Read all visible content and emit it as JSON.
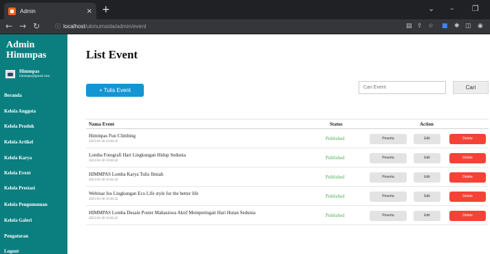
{
  "browser": {
    "tab_title": "Admin",
    "tab_close": "×",
    "new_tab": "+",
    "url_host": "localhost",
    "url_path": "/ukmumsida/admin/event",
    "controls": {
      "minimize": "–",
      "maximize": "❐",
      "chevron": "⌄"
    }
  },
  "sidebar": {
    "title": "Admin Himmpas",
    "profile": {
      "name": "Himmpas",
      "email": "himmpas@gmail.com"
    },
    "items": [
      {
        "label": "Beranda"
      },
      {
        "label": "Kelola Anggota"
      },
      {
        "label": "Kelola Produk"
      },
      {
        "label": "Kelola Artikel"
      },
      {
        "label": "Kelola Karya"
      },
      {
        "label": "Kelola Event"
      },
      {
        "label": "Kelola Prestasi"
      },
      {
        "label": "Kelola Pengumuman"
      },
      {
        "label": "Kelola Galeri"
      },
      {
        "label": "Pengaturan"
      },
      {
        "label": "Logout"
      }
    ]
  },
  "main": {
    "title": "List Event",
    "write_button": "+ Tulis Event",
    "search": {
      "placeholder": "Cari Event",
      "button": "Cari"
    },
    "table": {
      "headers": {
        "name": "Nama Event",
        "status": "Status",
        "action": "Action"
      },
      "rows": [
        {
          "name": "Himmpas Fun Climbing",
          "date": "2023-03-30 10:46:42",
          "status": "Published"
        },
        {
          "name": "Lomba Fotografi Hari Lingkungan Hidup Sedunia",
          "date": "2023-03-30 10:46:42",
          "status": "Published"
        },
        {
          "name": "HIMMPAS Lomba Karya Tulis Ilmiah",
          "date": "2023-03-30 10:46:42",
          "status": "Published"
        },
        {
          "name": "Webinar Isu Lingkungan Eco Life style for the better life",
          "date": "2023-03-30 10:46:42",
          "status": "Published"
        },
        {
          "name": "HIMMPAS Lomba Desain Poster Mahasiswa Aktif Memperingati Hari Hutan Sedunia",
          "date": "2023-03-30 10:46:42",
          "status": "Published"
        }
      ],
      "actions": {
        "peserta": "Peserta",
        "edit": "Edit",
        "delete": "Delete"
      }
    }
  },
  "colors": {
    "sidebar": "#0b7f80",
    "primary_button": "#1495d4",
    "status_published": "#4caf50",
    "delete_button": "#f44336"
  }
}
